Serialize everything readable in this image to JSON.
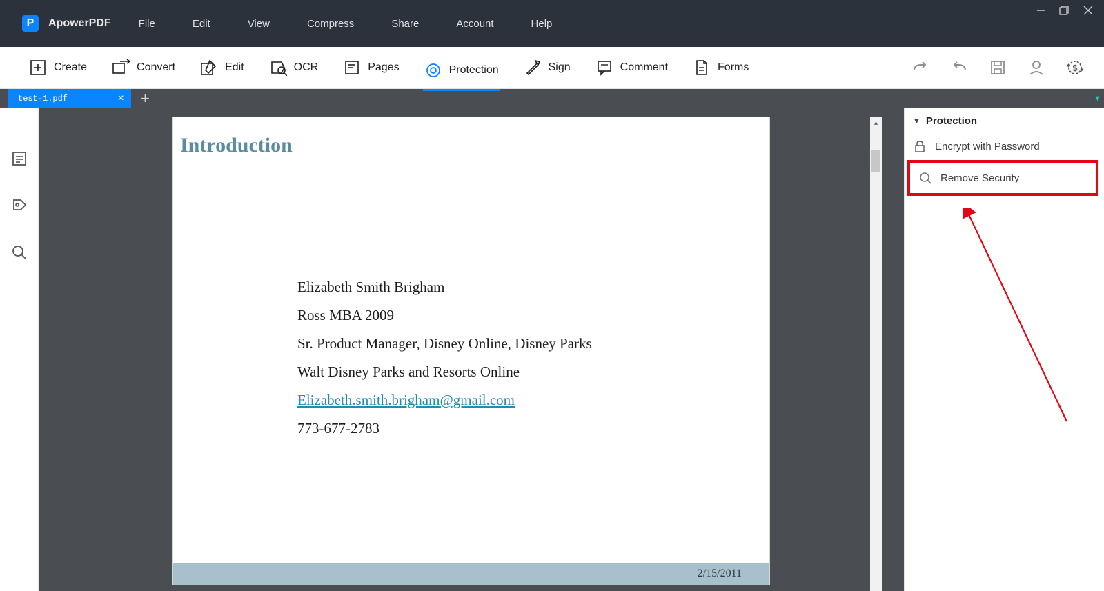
{
  "app": {
    "name": "ApowerPDF",
    "logo_letter": "P"
  },
  "menu": [
    "File",
    "Edit",
    "View",
    "Compress",
    "Share",
    "Account",
    "Help"
  ],
  "toolbar": [
    {
      "label": "Create"
    },
    {
      "label": "Convert"
    },
    {
      "label": "Edit"
    },
    {
      "label": "OCR"
    },
    {
      "label": "Pages"
    },
    {
      "label": "Protection"
    },
    {
      "label": "Sign"
    },
    {
      "label": "Comment"
    },
    {
      "label": "Forms"
    }
  ],
  "toolbar_active_index": 5,
  "tab": {
    "filename": "test-1.pdf"
  },
  "right_panel": {
    "title": "Protection",
    "items": [
      {
        "label": "Encrypt with Password"
      },
      {
        "label": "Remove Security"
      }
    ]
  },
  "document": {
    "heading": "Introduction",
    "lines": [
      "Elizabeth Smith Brigham",
      "Ross MBA 2009",
      "Sr. Product Manager, Disney Online, Disney Parks",
      "Walt Disney Parks and Resorts Online"
    ],
    "email": "Elizabeth.smith.brigham@gmail.com",
    "phone": "773-677-2783",
    "footer_date": "2/15/2011"
  }
}
